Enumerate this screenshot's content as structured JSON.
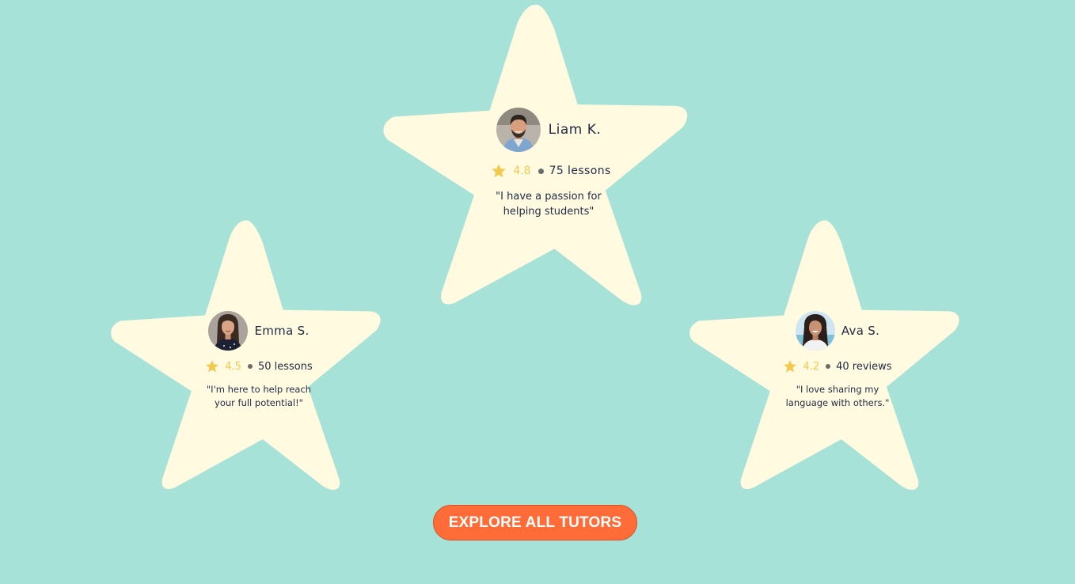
{
  "colors": {
    "background": "#a6e2d7",
    "card_fill": "#fffae0",
    "rating": "#f2c94c",
    "text": "#1f2b45",
    "cta": "#ff6c37"
  },
  "tutors": [
    {
      "name": "Liam K.",
      "rating": "4.8",
      "count_label": "75 lessons",
      "quote": "\"I have a passion for helping students\"",
      "avatar_icon": "man-portrait"
    },
    {
      "name": "Emma S.",
      "rating": "4.5",
      "count_label": "50 lessons",
      "quote": "\"I'm here to help reach your full potential!\"",
      "avatar_icon": "woman-portrait"
    },
    {
      "name": "Ava S.",
      "rating": "4.2",
      "count_label": "40 reviews",
      "quote": "\"I love sharing my language with others.\"",
      "avatar_icon": "woman-portrait"
    }
  ],
  "cta": {
    "label": "EXPLORE ALL TUTORS"
  }
}
